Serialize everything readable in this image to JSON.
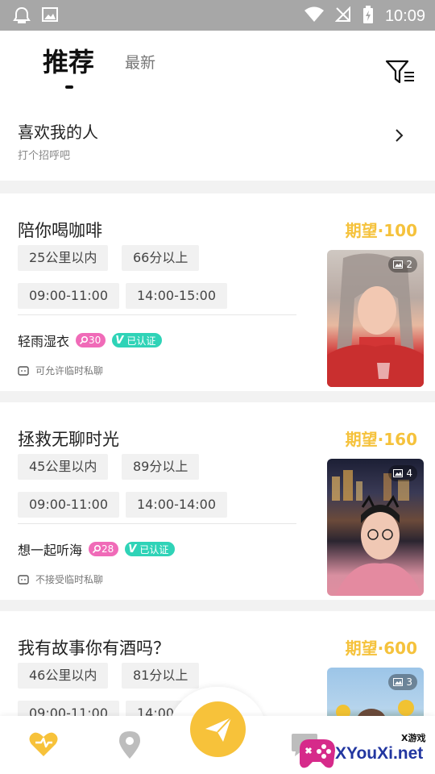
{
  "status_bar": {
    "time": "10:09"
  },
  "tabs": {
    "active": "推荐",
    "inactive": "最新"
  },
  "likes_section": {
    "title": "喜欢我的人",
    "subtitle": "打个招呼吧"
  },
  "cards": [
    {
      "title": "陪你喝咖啡",
      "expect": "期望·100",
      "distance": "25公里以内",
      "score": "66分以上",
      "time1": "09:00-11:00",
      "time2": "14:00-15:00",
      "user": "轻雨湿衣",
      "level": "30",
      "verified": "已认证",
      "chat": "可允许临时私聊",
      "photo_count": "2"
    },
    {
      "title": "拯救无聊时光",
      "expect": "期望·160",
      "distance": "45公里以内",
      "score": "89分以上",
      "time1": "09:00-11:00",
      "time2": "14:00-14:00",
      "user": "想一起听海",
      "level": "28",
      "verified": "已认证",
      "chat": "不接受临时私聊",
      "photo_count": "4"
    },
    {
      "title": "我有故事你有酒吗？",
      "expect": "期望·600",
      "distance": "46公里以内",
      "score": "81分以上",
      "time1": "09:00-11:00",
      "time2": "14:00-15:00",
      "photo_count": "3"
    }
  ],
  "bottom_nav": {
    "icons": [
      "heart-icon",
      "location-icon",
      "send-icon",
      "chat-icon"
    ],
    "accent": "#f7c23a"
  },
  "watermark": {
    "text": "XYouXi.net",
    "small": "X游戏"
  },
  "colors": {
    "expect": "#f5c23c",
    "level_badge": "#f06bb8",
    "verified_badge": "#2fd3b7",
    "status_bar": "#a7a7a7"
  }
}
